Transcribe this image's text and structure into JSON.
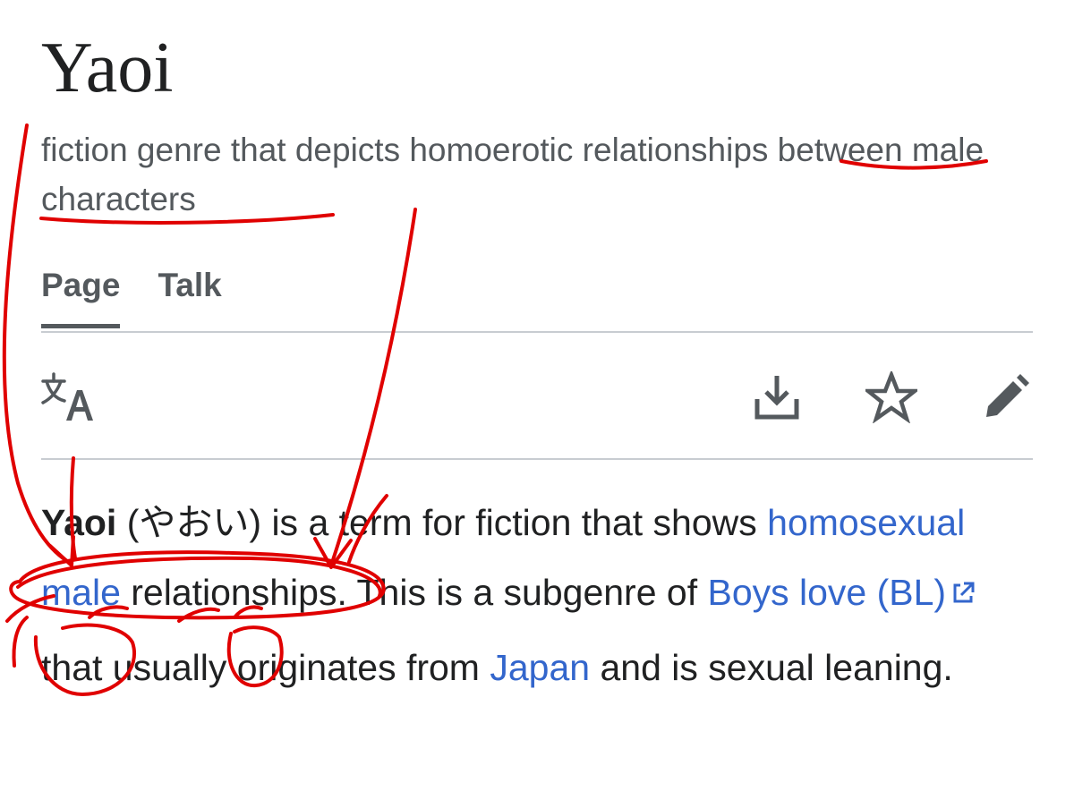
{
  "article": {
    "title": "Yaoi",
    "description": "fiction genre that depicts homoerotic relationships between male characters"
  },
  "tabs": [
    {
      "label": "Page",
      "selected": true
    },
    {
      "label": "Talk",
      "selected": false
    }
  ],
  "actions": {
    "language": "translate-icon",
    "download": "download-icon",
    "watch": "star-icon",
    "edit": "pencil-icon"
  },
  "lead": {
    "term": "Yaoi",
    "japanese": "(やおい)",
    "text1": " is a term for fiction that shows ",
    "link1": "homosexual male",
    "text2": " relationships. This is a subgenre of ",
    "link2": "Boys love (BL)",
    "text3": " that usually originates from ",
    "link3": "Japan",
    "text4": " and is sexual leaning."
  },
  "colors": {
    "link": "#3366cc",
    "annotation": "#e00000"
  }
}
